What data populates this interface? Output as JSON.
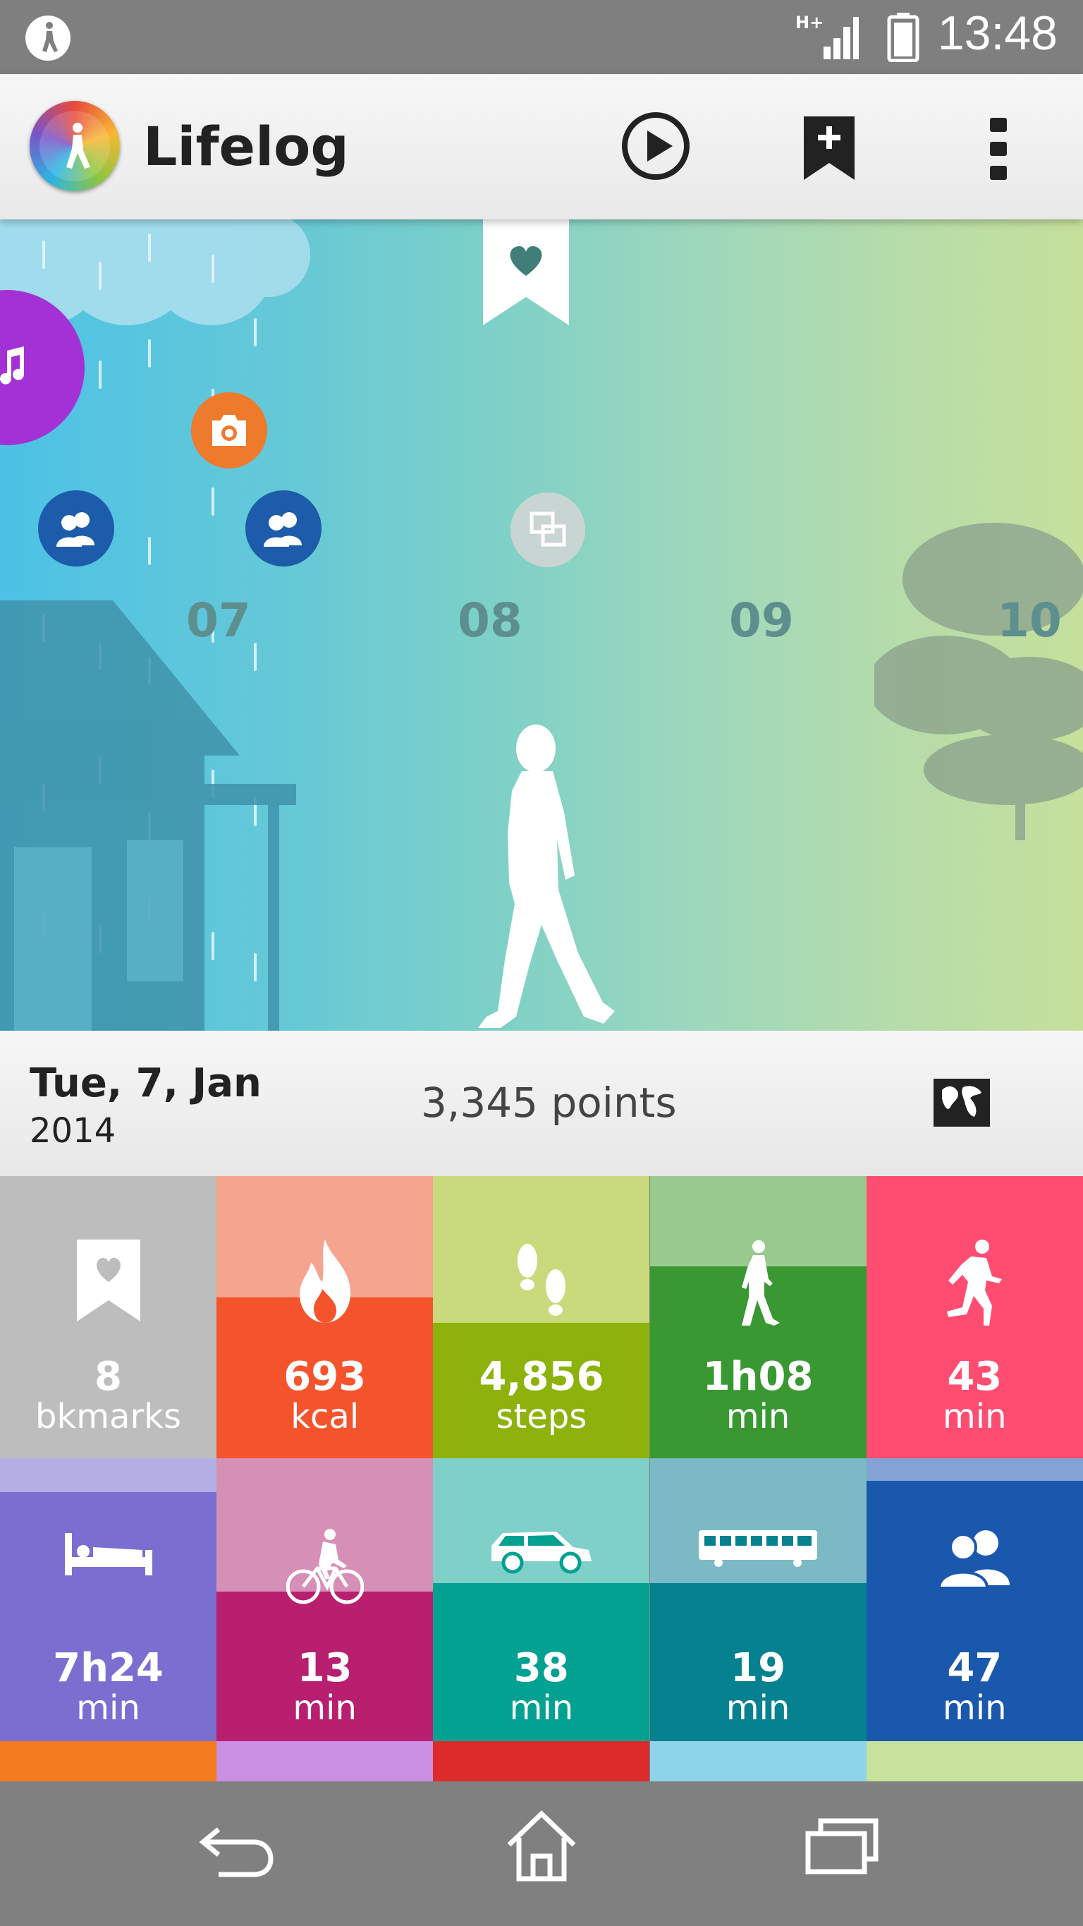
{
  "status_bar": {
    "time": "13:48",
    "network_label": "H+",
    "left_icon": "walking-person-icon"
  },
  "app_bar": {
    "title": "Lifelog",
    "actions": [
      "play-icon",
      "add-bookmark-icon",
      "overflow-menu-icon"
    ]
  },
  "timeline": {
    "hours": [
      "07",
      "08",
      "09",
      "10"
    ],
    "events": [
      "music-icon",
      "camera-icon",
      "people-icon",
      "people-icon",
      "app-switch-icon"
    ],
    "bookmark_icon": "heart-bookmark-icon"
  },
  "date_bar": {
    "day": "Tue, 7, Jan",
    "year": "2014",
    "points": "3,345 points",
    "map_icon": "world-map-icon"
  },
  "tiles": [
    {
      "value": "8",
      "unit": "bkmarks",
      "icon": "bookmark-heart-icon",
      "top_color": "#bdbdbd",
      "bottom_color": "#bdbdbd",
      "fill": 1.0
    },
    {
      "value": "693",
      "unit": "kcal",
      "icon": "flame-icon",
      "top_color": "#f5a490",
      "bottom_color": "#f4532b",
      "fill": 0.57
    },
    {
      "value": "4,856",
      "unit": "steps",
      "icon": "footsteps-icon",
      "top_color": "#c9da7d",
      "bottom_color": "#8cb20b",
      "fill": 0.48
    },
    {
      "value": "1h08",
      "unit": "min",
      "icon": "walking-icon",
      "top_color": "#99c98f",
      "bottom_color": "#3a9832",
      "fill": 0.68
    },
    {
      "value": "43",
      "unit": "min",
      "icon": "running-icon",
      "top_color": "#ff4d71",
      "bottom_color": "#ff4d71",
      "fill": 1.0
    },
    {
      "value": "7h24",
      "unit": "min",
      "icon": "bed-icon",
      "top_color": "#b3afe3",
      "bottom_color": "#7a6fd0",
      "fill": 0.88
    },
    {
      "value": "13",
      "unit": "min",
      "icon": "bicycle-icon",
      "top_color": "#d68fb6",
      "bottom_color": "#b81f6f",
      "fill": 0.53
    },
    {
      "value": "38",
      "unit": "min",
      "icon": "car-icon",
      "top_color": "#7fd0c8",
      "bottom_color": "#02a192",
      "fill": 0.56
    },
    {
      "value": "19",
      "unit": "min",
      "icon": "train-icon",
      "top_color": "#7bbac5",
      "bottom_color": "#06818f",
      "fill": 0.56
    },
    {
      "value": "47",
      "unit": "min",
      "icon": "people-icon",
      "top_color": "#82a3d4",
      "bottom_color": "#1a58ad",
      "fill": 0.92
    }
  ],
  "bottom_strip_colors": [
    "#f47a1f",
    "#c98fe2",
    "#dd2a2a",
    "#8dd3ea",
    "#c7e29c"
  ],
  "nav_bar": {
    "buttons": [
      "back-icon",
      "home-icon",
      "recent-apps-icon"
    ]
  }
}
